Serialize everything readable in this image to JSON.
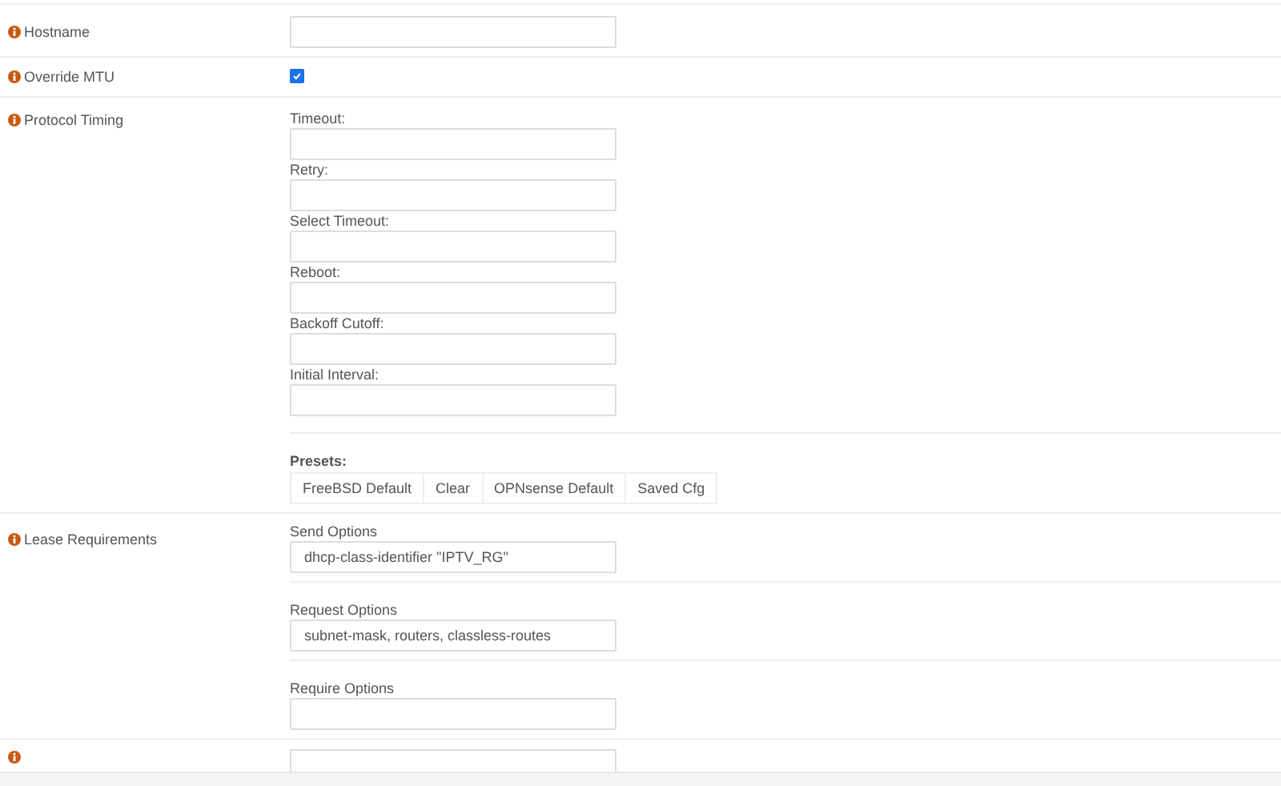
{
  "rows": [
    {
      "kind": "text",
      "label": "Hostname"
    },
    {
      "kind": "checkbox",
      "label": "Override MTU",
      "checked": true
    },
    {
      "kind": "timing",
      "label": "Protocol Timing",
      "fields": [
        {
          "label": "Timeout:"
        },
        {
          "label": "Retry:"
        },
        {
          "label": "Select Timeout:"
        },
        {
          "label": "Reboot:"
        },
        {
          "label": "Backoff Cutoff:"
        },
        {
          "label": "Initial Interval:"
        }
      ],
      "presets_label": "Presets:",
      "presets": [
        "FreeBSD Default",
        "Clear",
        "OPNsense Default",
        "Saved Cfg"
      ]
    },
    {
      "kind": "lease",
      "label": "Lease Requirements",
      "fields": [
        {
          "label": "Send Options",
          "value": "dhcp-class-identifier \"IPTV_RG\""
        },
        {
          "label": "Request Options",
          "value": "subnet-mask, routers, classless-routes"
        },
        {
          "label": "Require Options"
        }
      ]
    },
    {
      "kind": "partial"
    }
  ]
}
